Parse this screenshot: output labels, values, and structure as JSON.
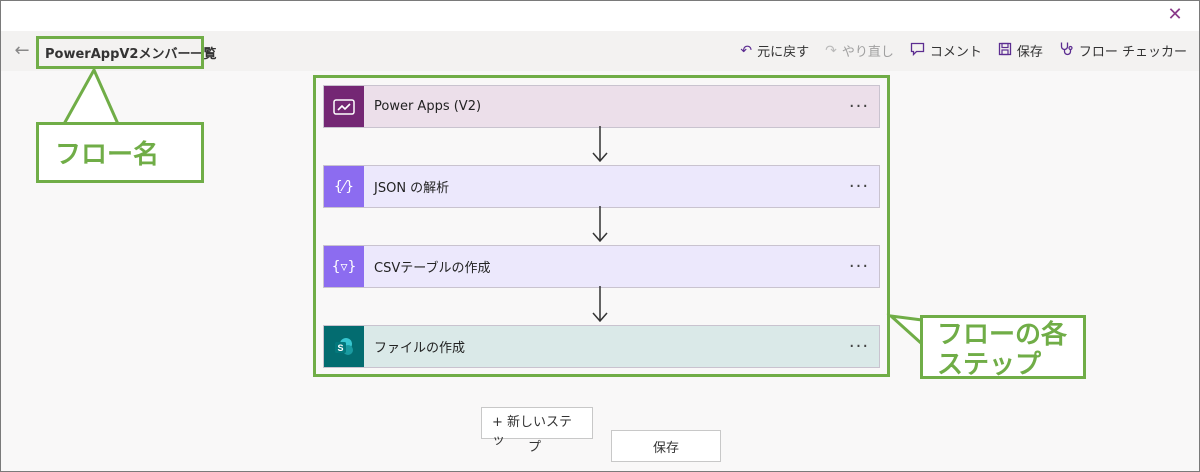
{
  "header": {
    "flow_name": "PowerAppV2メンバー一覧",
    "commands": [
      {
        "label": "元に戻す",
        "icon": "undo-icon",
        "enabled": true
      },
      {
        "label": "やり直し",
        "icon": "redo-icon",
        "enabled": false
      },
      {
        "label": "コメント",
        "icon": "comment-icon",
        "enabled": true
      },
      {
        "label": "保存",
        "icon": "save-icon",
        "enabled": true
      },
      {
        "label": "フロー チェッカー",
        "icon": "stethoscope-icon",
        "enabled": true
      }
    ]
  },
  "steps": [
    {
      "label": "Power Apps (V2)",
      "icon": "power-apps-icon",
      "color": "#742774"
    },
    {
      "label": "JSON の解析",
      "icon": "data-operation-icon",
      "color": "#8c6cf0"
    },
    {
      "label": "CSVテーブルの作成",
      "icon": "data-operation-icon",
      "color": "#8c6cf0"
    },
    {
      "label": "ファイルの作成",
      "icon": "sharepoint-icon",
      "color": "#036c70"
    }
  ],
  "step_more": "···",
  "footer": {
    "new_step": "+ 新しいステッ",
    "new_step_overflow": "プ",
    "save": "保存"
  },
  "annotations": {
    "flow_name_callout": "フロー名",
    "steps_callout_line1": "フローの各",
    "steps_callout_line2": "ステップ",
    "accent": "#70ad47"
  }
}
